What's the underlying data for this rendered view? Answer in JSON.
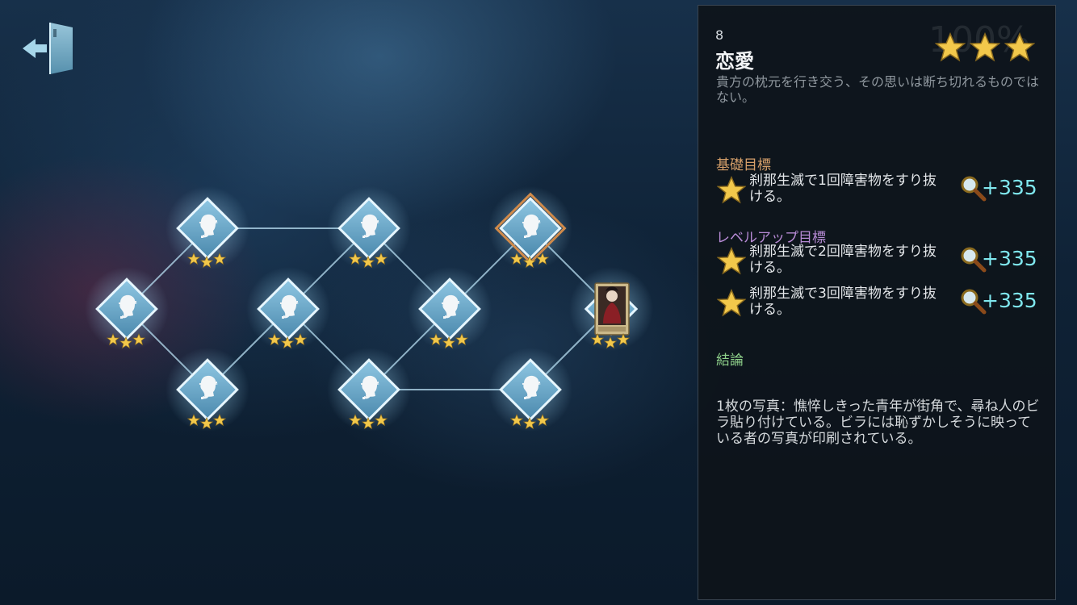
{
  "panel": {
    "background_label": "100%",
    "level_number": "8",
    "level_title": "恋愛",
    "level_description": "貴方の枕元を行き交う、その思いは断ち切れるものではない。",
    "basic_goal_label": "基礎目標",
    "basic_goals": [
      {
        "text": "刹那生滅で1回障害物をすり抜ける。",
        "reward": "+335"
      }
    ],
    "levelup_goal_label": "レベルアップ目標",
    "levelup_goals": [
      {
        "text": "刹那生滅で2回障害物をすり抜ける。",
        "reward": "+335"
      },
      {
        "text": "刹那生滅で3回障害物をすり抜ける。",
        "reward": "+335"
      }
    ],
    "conclusion_label": "結論",
    "conclusion_text": "1枚の写真：憔悴しきった青年が街角で、尋ね人のビラ貼り付けている。ビラには恥ずかしそうに映っている者の写真が印刷されている。",
    "stars_earned": 3,
    "stars_max": 3
  },
  "map": {
    "nodes": [
      {
        "id": 1,
        "type": "detective",
        "stars": 3
      },
      {
        "id": 2,
        "type": "detective",
        "stars": 3
      },
      {
        "id": 3,
        "type": "detective",
        "stars": 3
      },
      {
        "id": 4,
        "type": "detective",
        "stars": 3
      },
      {
        "id": 5,
        "type": "detective",
        "stars": 3
      },
      {
        "id": 6,
        "type": "detective",
        "stars": 3
      },
      {
        "id": 7,
        "type": "detective",
        "stars": 3
      },
      {
        "id": 8,
        "type": "detective",
        "stars": 3,
        "selected": true
      },
      {
        "id": 9,
        "type": "detective",
        "stars": 3
      },
      {
        "id": 10,
        "type": "character-card",
        "stars": 3
      }
    ]
  },
  "colors": {
    "star_gold": "#f2c84b",
    "node_blue": "#6fb1d8",
    "selected_border": "#d08a4a",
    "reward_cyan": "#7fe7ee"
  },
  "icons": {
    "exit": "exit-door-icon",
    "node": "detective-silhouette-icon",
    "reward": "magnifier-icon"
  }
}
